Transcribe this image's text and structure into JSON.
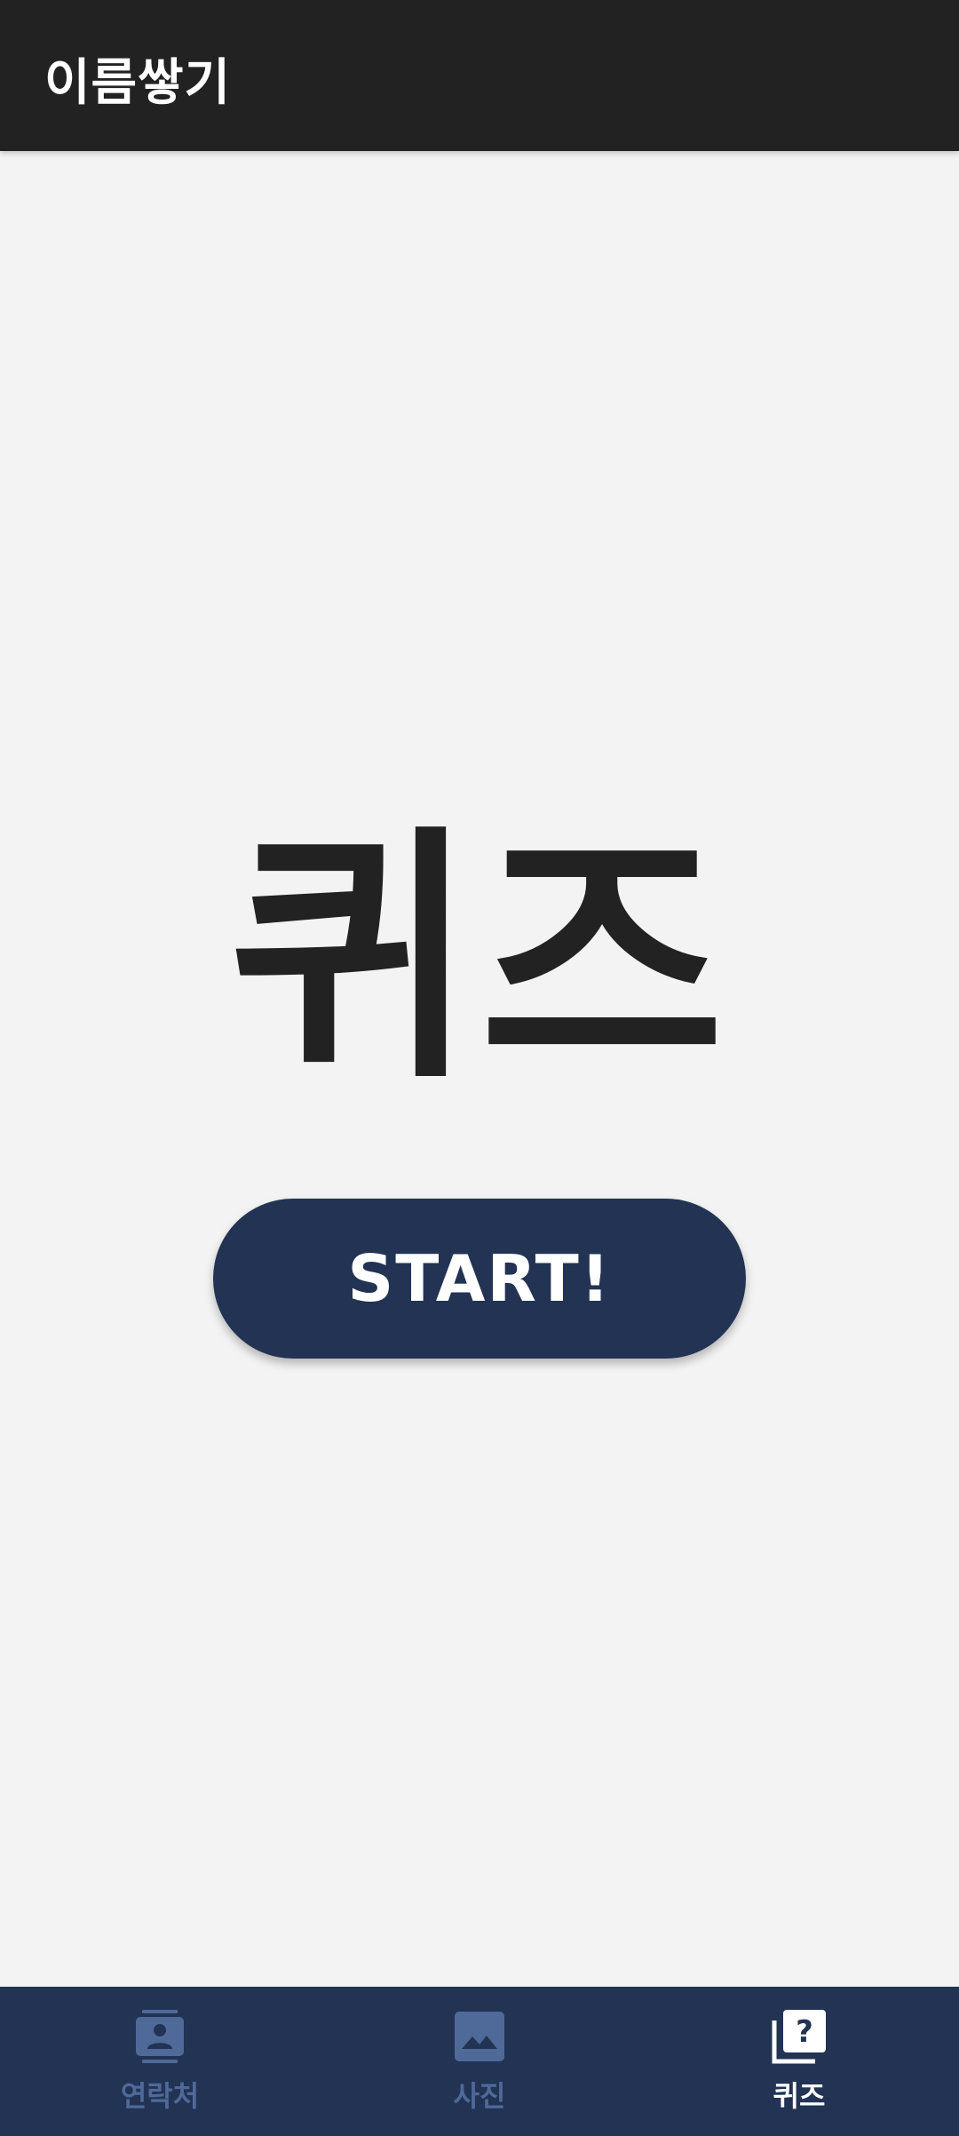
{
  "appbar": {
    "title": "이름쌓기"
  },
  "main": {
    "quiz_title": "퀴즈",
    "start_label": "START!"
  },
  "bottom_nav": {
    "items": [
      {
        "label": "연락처",
        "icon": "contacts-icon",
        "active": false
      },
      {
        "label": "사진",
        "icon": "image-icon",
        "active": false
      },
      {
        "label": "퀴즈",
        "icon": "quiz-icon",
        "active": true
      }
    ]
  },
  "colors": {
    "appbar": "#222222",
    "background": "#f3f3f3",
    "accent": "#223354",
    "nav_inactive": "#4f6a99",
    "nav_active": "#ffffff",
    "text_dark": "#222222"
  }
}
